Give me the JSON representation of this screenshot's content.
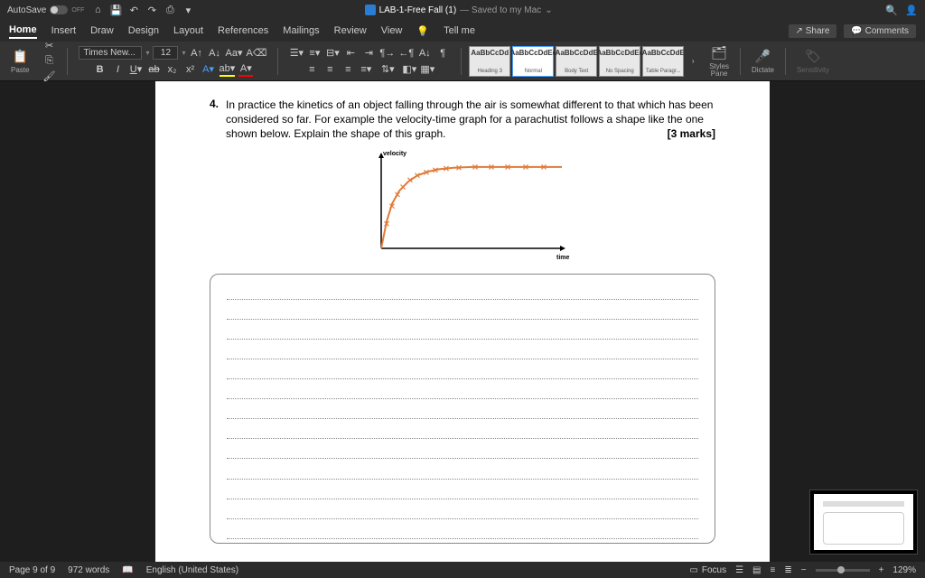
{
  "titlebar": {
    "autosave_label": "AutoSave",
    "autosave_state": "OFF",
    "doc_title": "LAB-1-Free Fall (1)",
    "save_status": "— Saved to my Mac",
    "dropdown_glyph": "⌄"
  },
  "tabs": {
    "items": [
      "Home",
      "Insert",
      "Draw",
      "Design",
      "Layout",
      "References",
      "Mailings",
      "Review",
      "View"
    ],
    "active_index": 0,
    "tellme": "Tell me",
    "share": "Share",
    "comments": "Comments"
  },
  "ribbon": {
    "paste_label": "Paste",
    "font_name": "Times New...",
    "font_size": "12",
    "styles": [
      {
        "preview": "AaBbCcDd",
        "label": "Heading 3"
      },
      {
        "preview": "AaBbCcDdEe",
        "label": "Normal"
      },
      {
        "preview": "AaBbCcDdE",
        "label": "Body Text"
      },
      {
        "preview": "AaBbCcDdEe",
        "label": "No Spacing"
      },
      {
        "preview": "AaBbCcDdE",
        "label": "Table Paragr..."
      }
    ],
    "selected_style": 1,
    "styles_pane": "Styles\nPane",
    "dictate": "Dictate",
    "sensitivity": "Sensitivity"
  },
  "document": {
    "question_number": "4.",
    "question_text": "In practice the kinetics of an object falling through the air is somewhat different to that which has been considered so far. For example the velocity-time graph for a parachutist follows a shape like the one shown below. Explain the shape of this graph.",
    "marks": "[3 marks]",
    "answer_lines": 13
  },
  "chart_data": {
    "type": "line",
    "title": "",
    "xlabel": "time",
    "ylabel": "velocity",
    "xlim": [
      0,
      10
    ],
    "ylim": [
      0,
      12
    ],
    "x": [
      0,
      0.3,
      0.6,
      1.0,
      1.5,
      2.0,
      2.6,
      3.2,
      4.0,
      5.0,
      6.0,
      7.5,
      9.0,
      10.0
    ],
    "y": [
      0,
      3.5,
      5.8,
      7.5,
      8.7,
      9.5,
      10.0,
      10.3,
      10.5,
      10.6,
      10.6,
      10.6,
      10.6,
      10.6
    ],
    "color": "#e07b3a",
    "markers_x": [
      0.3,
      0.6,
      0.9,
      1.2,
      1.6,
      2.0,
      2.5,
      3.0,
      3.6,
      4.3,
      5.2,
      6.1,
      7.0,
      8.0,
      9.0
    ],
    "markers_y": [
      3.2,
      5.5,
      7.0,
      8.0,
      8.9,
      9.5,
      9.9,
      10.2,
      10.4,
      10.5,
      10.6,
      10.6,
      10.6,
      10.6,
      10.6
    ]
  },
  "statusbar": {
    "page": "Page 9 of 9",
    "words": "972 words",
    "language": "English (United States)",
    "focus": "Focus",
    "zoom": "129%"
  }
}
